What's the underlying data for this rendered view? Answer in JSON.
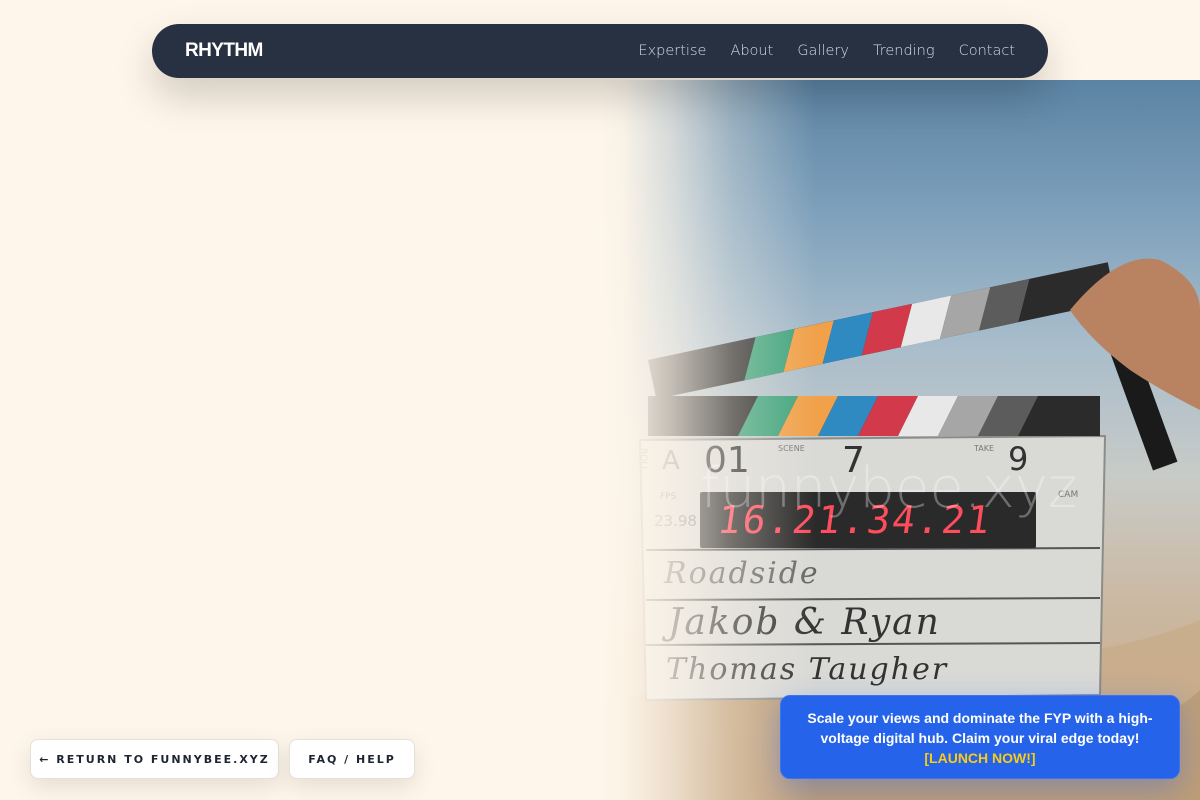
{
  "navbar": {
    "brand": "RHYTHM",
    "links": [
      "Expertise",
      "About",
      "Gallery",
      "Trending",
      "Contact"
    ]
  },
  "hero": {
    "watermark": "funnybee.xyz",
    "clapper": {
      "roll": "A",
      "scene": "01",
      "shot": "7",
      "take": "9",
      "fps": "23.98",
      "fps_label": "FPS",
      "timecode": "16.21.34.21",
      "title": "Roadside",
      "director": "Jakob & Ryan",
      "camera": "Thomas Taugher",
      "scene_label": "SCENE",
      "take_label": "TAKE",
      "cam_label": "CAM",
      "roll_label": "ROLL"
    }
  },
  "buttons": {
    "return_label": "← RETURN TO FUNNYBEE.XYZ",
    "faq_label": "FAQ / HELP"
  },
  "cta": {
    "text": "Scale your views and dominate the FYP with a high-voltage digital hub. Claim your viral edge today!",
    "link": "[LAUNCH NOW!]"
  },
  "colors": {
    "background": "#fef6ea",
    "navbar": "#283142",
    "cta": "#2563eb",
    "cta_link": "#facc15"
  }
}
